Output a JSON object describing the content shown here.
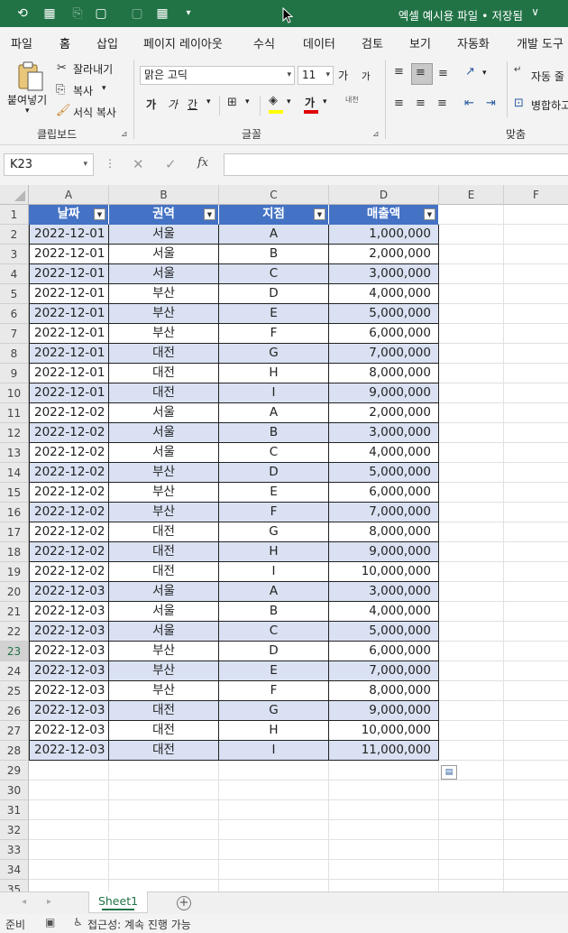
{
  "titlebar": {
    "title": "엑셀 예시용 파일 • 저장됨",
    "chevron": "∨",
    "qat_icons": [
      "autosave-icon",
      "table-grid-icon",
      "clipboard-icon",
      "new-sheet-icon",
      "blank-sheet-icon",
      "insert-table-icon",
      "customize-dropdown-icon"
    ]
  },
  "menu": {
    "tabs": [
      "파일",
      "홈",
      "삽입",
      "페이지 레이아웃",
      "수식",
      "데이터",
      "검토",
      "보기",
      "자동화",
      "개발 도구"
    ],
    "active": "홈"
  },
  "ribbon": {
    "clipboard": {
      "paste": "붙여넣기",
      "cut": "잘라내기",
      "copy": "복사",
      "format_painter": "서식 복사",
      "group_label": "클립보드"
    },
    "font": {
      "font_name": "맑은 고딕",
      "font_size": "11",
      "grow": "가",
      "shrink": "가",
      "bold": "가",
      "italic": "가",
      "underline": "간",
      "font_color_glyph": "가",
      "phonetic": "내천",
      "group_label": "글꼴"
    },
    "alignment": {
      "wrap_text": "자동 줄",
      "merge": "병합하고",
      "group_label": "맞춤"
    }
  },
  "formula_bar": {
    "name_box": "K23",
    "cancel_glyph": "✕",
    "enter_glyph": "✓",
    "fx": "fx",
    "formula": ""
  },
  "grid": {
    "columns": [
      "A",
      "B",
      "C",
      "D",
      "E",
      "F"
    ],
    "selected_row": "23",
    "table_headers": [
      "날짜",
      "권역",
      "지점",
      "매출액"
    ],
    "rows": [
      [
        "2022-12-01",
        "서울",
        "A",
        "1,000,000"
      ],
      [
        "2022-12-01",
        "서울",
        "B",
        "2,000,000"
      ],
      [
        "2022-12-01",
        "서울",
        "C",
        "3,000,000"
      ],
      [
        "2022-12-01",
        "부산",
        "D",
        "4,000,000"
      ],
      [
        "2022-12-01",
        "부산",
        "E",
        "5,000,000"
      ],
      [
        "2022-12-01",
        "부산",
        "F",
        "6,000,000"
      ],
      [
        "2022-12-01",
        "대전",
        "G",
        "7,000,000"
      ],
      [
        "2022-12-01",
        "대전",
        "H",
        "8,000,000"
      ],
      [
        "2022-12-01",
        "대전",
        "I",
        "9,000,000"
      ],
      [
        "2022-12-02",
        "서울",
        "A",
        "2,000,000"
      ],
      [
        "2022-12-02",
        "서울",
        "B",
        "3,000,000"
      ],
      [
        "2022-12-02",
        "서울",
        "C",
        "4,000,000"
      ],
      [
        "2022-12-02",
        "부산",
        "D",
        "5,000,000"
      ],
      [
        "2022-12-02",
        "부산",
        "E",
        "6,000,000"
      ],
      [
        "2022-12-02",
        "부산",
        "F",
        "7,000,000"
      ],
      [
        "2022-12-02",
        "대전",
        "G",
        "8,000,000"
      ],
      [
        "2022-12-02",
        "대전",
        "H",
        "9,000,000"
      ],
      [
        "2022-12-02",
        "대전",
        "I",
        "10,000,000"
      ],
      [
        "2022-12-03",
        "서울",
        "A",
        "3,000,000"
      ],
      [
        "2022-12-03",
        "서울",
        "B",
        "4,000,000"
      ],
      [
        "2022-12-03",
        "서울",
        "C",
        "5,000,000"
      ],
      [
        "2022-12-03",
        "부산",
        "D",
        "6,000,000"
      ],
      [
        "2022-12-03",
        "부산",
        "E",
        "7,000,000"
      ],
      [
        "2022-12-03",
        "부산",
        "F",
        "8,000,000"
      ],
      [
        "2022-12-03",
        "대전",
        "G",
        "9,000,000"
      ],
      [
        "2022-12-03",
        "대전",
        "H",
        "10,000,000"
      ],
      [
        "2022-12-03",
        "대전",
        "I",
        "11,000,000"
      ]
    ],
    "row_numbers": [
      "1",
      "2",
      "3",
      "4",
      "5",
      "6",
      "7",
      "8",
      "9",
      "10",
      "11",
      "12",
      "13",
      "14",
      "15",
      "16",
      "17",
      "18",
      "19",
      "20",
      "21",
      "22",
      "23",
      "24",
      "25",
      "26",
      "27",
      "28",
      "29",
      "30",
      "31",
      "32",
      "33",
      "34",
      "35"
    ]
  },
  "sheets": {
    "tabs": [
      "Sheet1"
    ],
    "add_glyph": "+"
  },
  "status": {
    "ready": "준비",
    "accessibility": "접근성: 계속 진행 가능"
  },
  "colors": {
    "brand_green": "#217346",
    "table_header": "#4472c4",
    "table_band": "#d9e1f2"
  }
}
